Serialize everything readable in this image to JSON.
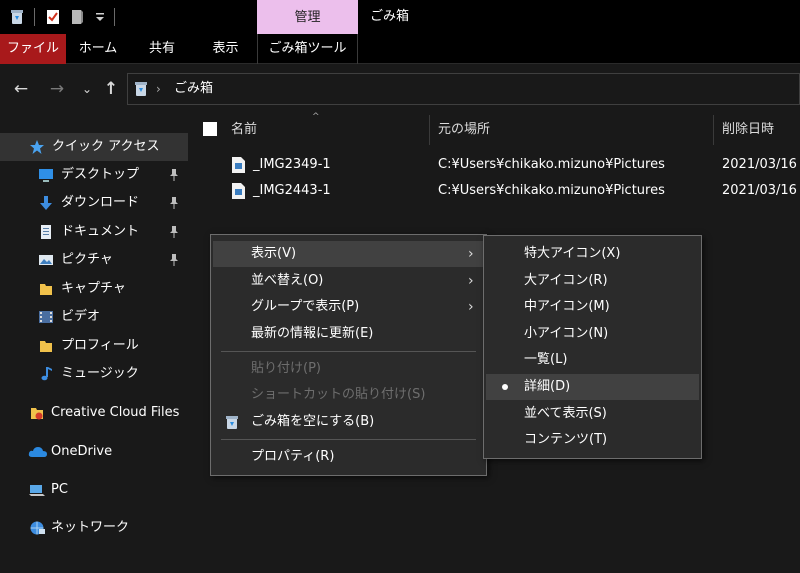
{
  "titlebar": {
    "contextual_tab": "管理",
    "window_title": "ごみ箱"
  },
  "ribbon": {
    "tabs": [
      "ファイル",
      "ホーム",
      "共有",
      "表示",
      "ごみ箱ツール"
    ]
  },
  "address": {
    "back_icon": "←",
    "forward_icon": "→",
    "recent_icon": "⌄",
    "up_icon": "↑",
    "separator": "›",
    "location": "ごみ箱"
  },
  "sidebar": {
    "items": [
      {
        "label": "クイック アクセス",
        "icon": "star-icon"
      },
      {
        "label": "デスクトップ",
        "icon": "desktop-icon"
      },
      {
        "label": "ダウンロード",
        "icon": "download-icon"
      },
      {
        "label": "ドキュメント",
        "icon": "document-icon"
      },
      {
        "label": "ピクチャ",
        "icon": "pictures-icon"
      },
      {
        "label": "キャプチャ",
        "icon": "folder-icon"
      },
      {
        "label": "ビデオ",
        "icon": "video-icon"
      },
      {
        "label": "プロフィール",
        "icon": "folder-icon"
      },
      {
        "label": "ミュージック",
        "icon": "music-icon"
      },
      {
        "label": "Creative Cloud Files",
        "icon": "creative-cloud-icon"
      },
      {
        "label": "OneDrive",
        "icon": "onedrive-icon"
      },
      {
        "label": "PC",
        "icon": "pc-icon"
      },
      {
        "label": "ネットワーク",
        "icon": "network-icon"
      }
    ]
  },
  "filelist": {
    "sort_indicator": "^",
    "columns": [
      "名前",
      "元の場所",
      "削除日時"
    ],
    "rows": [
      {
        "name": "_IMG2349-1",
        "location": "C:¥Users¥chikako.mizuno¥Pictures",
        "deleted": "2021/03/16"
      },
      {
        "name": "_IMG2443-1",
        "location": "C:¥Users¥chikako.mizuno¥Pictures",
        "deleted": "2021/03/16"
      }
    ]
  },
  "context_menu": {
    "submenu_arrow": "›",
    "items": [
      {
        "label": "表示(V)"
      },
      {
        "label": "並べ替え(O)"
      },
      {
        "label": "グループで表示(P)"
      },
      {
        "label": "最新の情報に更新(E)"
      },
      {
        "label": "貼り付け(P)"
      },
      {
        "label": "ショートカットの貼り付け(S)"
      },
      {
        "label": "ごみ箱を空にする(B)"
      },
      {
        "label": "プロパティ(R)"
      }
    ]
  },
  "view_submenu": {
    "selected": "詳細(D)",
    "items": [
      {
        "label": "特大アイコン(X)"
      },
      {
        "label": "大アイコン(R)"
      },
      {
        "label": "中アイコン(M)"
      },
      {
        "label": "小アイコン(N)"
      },
      {
        "label": "一覧(L)"
      },
      {
        "label": "詳細(D)"
      },
      {
        "label": "並べて表示(S)"
      },
      {
        "label": "コンテンツ(T)"
      }
    ]
  },
  "colors": {
    "file_tab": "#a8191b",
    "manage_tab": "#ecbfec",
    "quick_access_star": "#4aa3f0"
  }
}
